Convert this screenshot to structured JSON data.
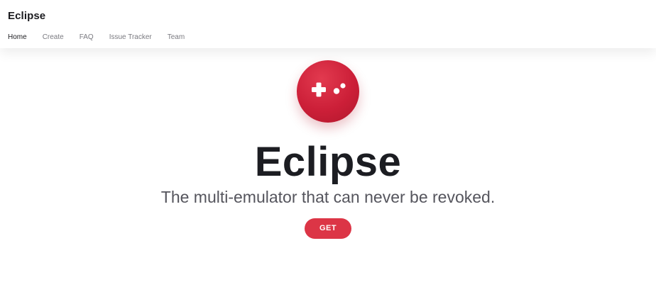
{
  "header": {
    "brand": "Eclipse",
    "nav": [
      {
        "label": "Home",
        "active": true
      },
      {
        "label": "Create",
        "active": false
      },
      {
        "label": "FAQ",
        "active": false
      },
      {
        "label": "Issue Tracker",
        "active": false
      },
      {
        "label": "Team",
        "active": false
      }
    ]
  },
  "hero": {
    "logo_icon": "gamepad-icon",
    "title": "Eclipse",
    "subtitle": "The multi-emulator that can never be revoked.",
    "cta_label": "GET"
  },
  "colors": {
    "accent": "#dc3546",
    "title_text": "#1c1d22",
    "subtitle_text": "#55555d"
  }
}
